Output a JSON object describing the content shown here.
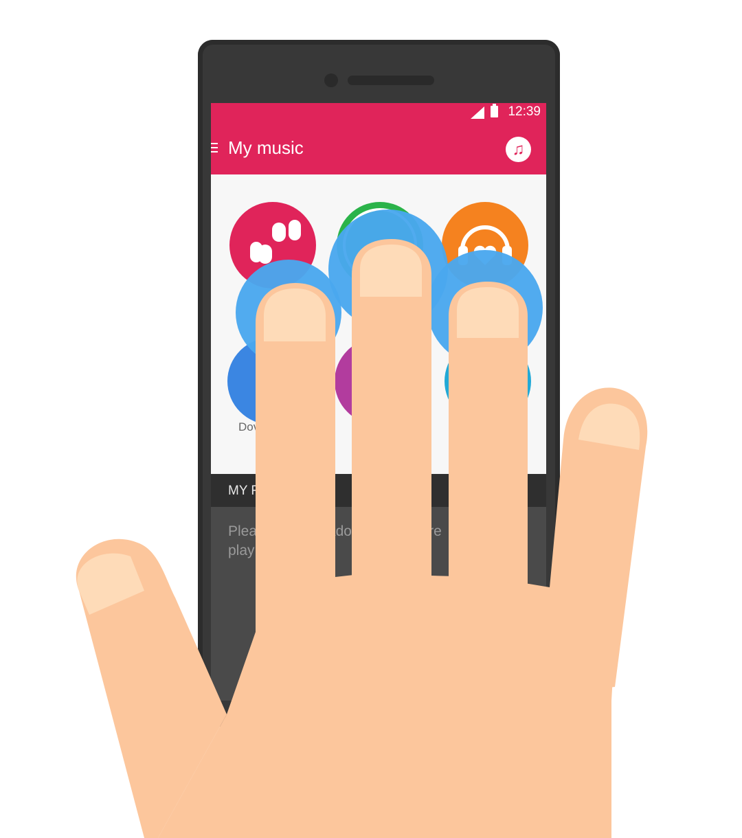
{
  "status_bar": {
    "time": "12:39"
  },
  "app_bar": {
    "title": "My music",
    "menu_icon": "hamburger-icon",
    "action_icon": "music-note-icon"
  },
  "tiles": [
    {
      "name": "tile-earphones",
      "icon": "earphones-icon",
      "color": "#e0245a"
    },
    {
      "name": "tile-green",
      "icon": "circle-icon",
      "color": "#2bb34a"
    },
    {
      "name": "tile-headphones-heart",
      "icon": "headphones-heart-icon",
      "color": "#f5821f"
    },
    {
      "name": "tile-downloads",
      "icon": "download-icon",
      "color": "#3b86e2",
      "label": "Dov"
    },
    {
      "name": "tile-purple",
      "icon": "circle-icon",
      "color": "#b23c9e"
    },
    {
      "name": "tile-cyan",
      "icon": "circle-icon",
      "color": "#22a9d6"
    }
  ],
  "section": {
    "header": "MY F"
  },
  "panel": {
    "line1": "Plea",
    "line1b": "Ado",
    "line1c": "cre",
    "line2": "play"
  },
  "gesture": {
    "touch_color": "#4aa8ee",
    "skin_color": "#fcc69c",
    "nail_color": "#fedbb8",
    "fingers": 3
  }
}
